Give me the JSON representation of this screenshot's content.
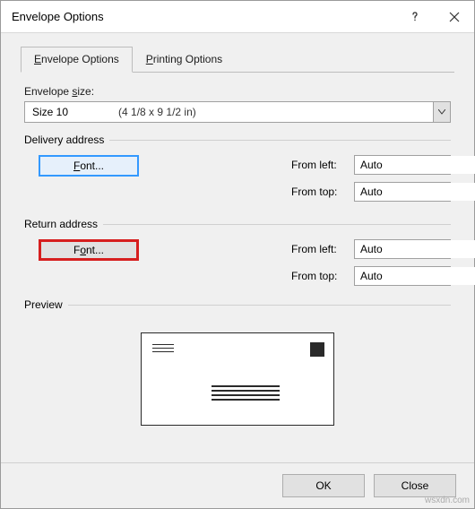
{
  "window": {
    "title": "Envelope Options"
  },
  "tabs": {
    "envelope": {
      "prefix": "E",
      "rest": "nvelope Options"
    },
    "printing": {
      "prefix": "P",
      "rest": "rinting Options"
    }
  },
  "envelope_size": {
    "label_prefix": "Envelope ",
    "label_u": "s",
    "label_rest": "ize:",
    "value": "Size 10",
    "dim": "(4 1/8 x 9 1/2 in)"
  },
  "delivery": {
    "header": "Delivery address",
    "font_u": "F",
    "font_rest": "ont...",
    "from_left_u": "l",
    "from_left_pre": "From ",
    "from_left_post": "eft:",
    "from_top_u": "t",
    "from_top_pre": "From ",
    "from_top_post": "op:",
    "left_value": "Auto",
    "top_value": "Auto"
  },
  "return": {
    "header": "Return address",
    "font_u": "o",
    "font_pre": "F",
    "font_post": "nt...",
    "from_left_u": "m",
    "from_left_pre": "Fro",
    "from_left_post": " left:",
    "from_top_u": "r",
    "from_top_pre": "F",
    "from_top_post": "om top:",
    "left_value": "Auto",
    "top_value": "Auto"
  },
  "preview": {
    "header": "Preview"
  },
  "footer": {
    "ok": "OK",
    "close": "Close"
  },
  "watermark": "wsxdn.com"
}
